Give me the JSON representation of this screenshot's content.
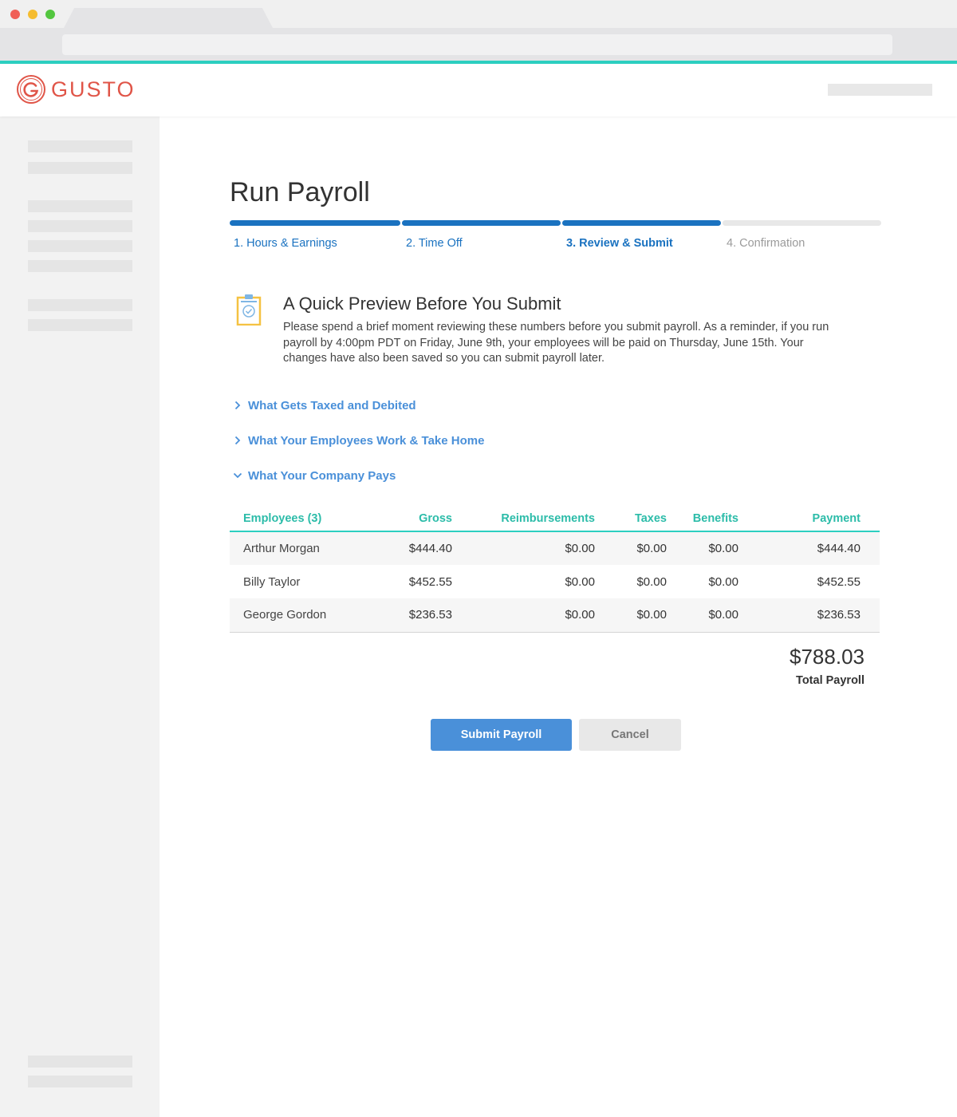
{
  "browser": {
    "controls": [
      "close",
      "minimize",
      "maximize"
    ]
  },
  "brand": {
    "name": "GUSTO",
    "color": "#e05548",
    "icon": "gusto-logo-icon"
  },
  "page": {
    "title": "Run Payroll"
  },
  "stepper": {
    "steps": [
      {
        "label": "1. Hours & Earnings",
        "status": "complete"
      },
      {
        "label": "2. Time Off",
        "status": "complete"
      },
      {
        "label": "3. Review & Submit",
        "status": "current"
      },
      {
        "label": "4. Confirmation",
        "status": "upcoming"
      }
    ],
    "active_color": "#1a72c0"
  },
  "preview": {
    "icon": "clipboard-check-icon",
    "title": "A Quick Preview Before You Submit",
    "body": "Please spend a brief moment reviewing these numbers before you submit payroll. As a reminder, if you run payroll by 4:00pm PDT on Friday, June 9th, your employees will be paid on Thursday, June 15th. Your changes have also been saved so you can submit payroll later."
  },
  "accordions": [
    {
      "label": "What Gets Taxed and Debited",
      "expanded": false
    },
    {
      "label": "What Your Employees Work & Take Home",
      "expanded": false
    },
    {
      "label": "What Your Company Pays",
      "expanded": true
    }
  ],
  "table": {
    "headers": [
      "Employees (3)",
      "Gross",
      "Reimbursements",
      "Taxes",
      "Benefits",
      "Payment"
    ],
    "rows": [
      [
        "Arthur Morgan",
        "$444.40",
        "$0.00",
        "$0.00",
        "$0.00",
        "$444.40"
      ],
      [
        "Billy Taylor",
        "$452.55",
        "$0.00",
        "$0.00",
        "$0.00",
        "$452.55"
      ],
      [
        "George Gordon",
        "$236.53",
        "$0.00",
        "$0.00",
        "$0.00",
        "$236.53"
      ]
    ],
    "header_color": "#2cbca9"
  },
  "total": {
    "amount": "$788.03",
    "label": "Total Payroll"
  },
  "actions": {
    "submit_label": "Submit Payroll",
    "cancel_label": "Cancel",
    "primary_color": "#4a90d9"
  }
}
